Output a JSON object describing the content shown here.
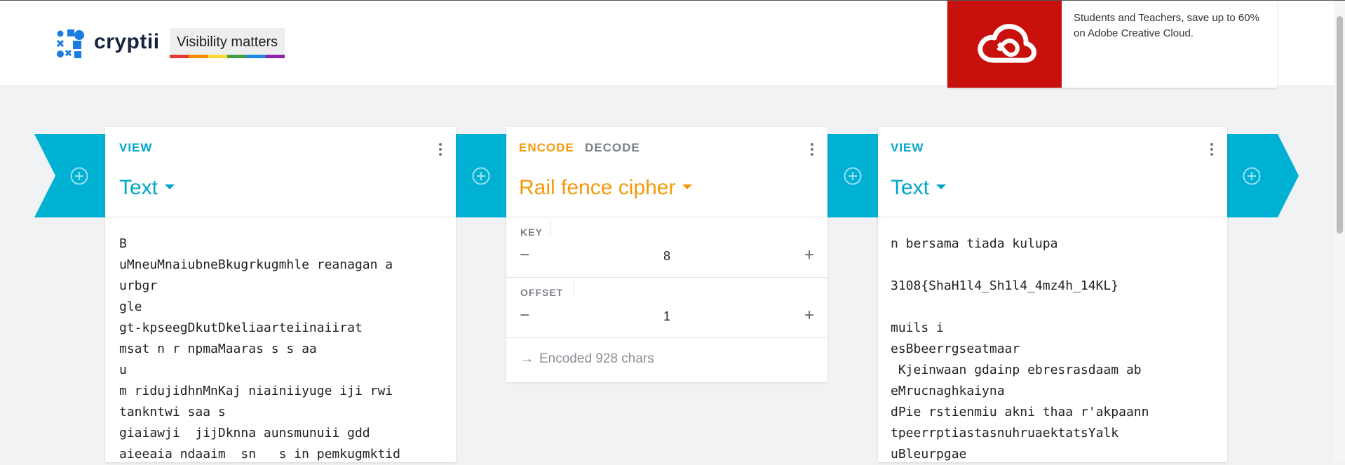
{
  "brand": {
    "name": "cryptii",
    "badge": "Visibility matters"
  },
  "ad": {
    "text": "Students and Teachers, save up to 60% on Adobe Creative Cloud."
  },
  "colors": {
    "accent_blue": "#00b1d4",
    "accent_orange": "#f5990a",
    "ad_red": "#c8100d"
  },
  "left_view": {
    "tab": "VIEW",
    "brick": "Text",
    "content": "B\nuMneuMnaiubneBkugrkugmhle reanagan a\nurbgr\ngle\ngt-kpseegDkutDkeliaarteiinaiirat\nmsat n r npmaMaaras s s aa\nu\nm ridujidhnMnKaj niainiiyuge iji rwi\ntankntwi saa s\ngiaiawji  jijDknna aunsmunuii gdd\naieeaia ndaaim  sn   s in pemkugmktid"
  },
  "encoder": {
    "tab_encode": "ENCODE",
    "tab_decode": "DECODE",
    "brick": "Rail fence cipher",
    "key_label": "KEY",
    "key_value": "8",
    "offset_label": "OFFSET",
    "offset_value": "1",
    "status": "Encoded 928 chars"
  },
  "right_view": {
    "tab": "VIEW",
    "brick": "Text",
    "content": "n bersama tiada kulupa\n\n3108{ShaH1l4_Sh1l4_4mz4h_14KL}\n\nmuils i\nesBbeerrgseatmaar\n Kjeinwaan gdainp ebresrasdaam ab\neMrucnaghkaiyna\ndPie rstienmiu akni thaa r'akpaann\ntpeerrptiastasnuhruaektatsYalk\nuBleurpgae"
  }
}
